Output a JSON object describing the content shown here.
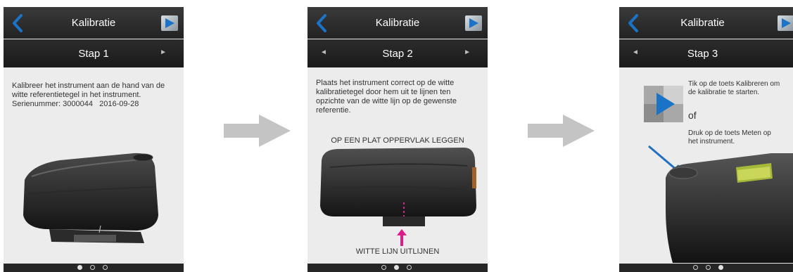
{
  "screens": [
    {
      "title": "Kalibratie",
      "step": "Stap 1",
      "description": [
        "Kalibreer het instrument aan de hand van de",
        "witte referentietegel in het instrument."
      ],
      "serial_label": "Serienummer: 3000044",
      "date": "2016-09-28"
    },
    {
      "title": "Kalibratie",
      "step": "Stap 2",
      "description": [
        "Plaats het instrument correct op de witte",
        "kalibratietegel door hem uit te lijnen ten",
        "opzichte van de witte lijn op de gewenste",
        "referentie."
      ],
      "top_caption": "OP EEN PLAT OPPERVLAK LEGGEN",
      "bottom_caption": "WITTE LIJN UITLIJNEN"
    },
    {
      "title": "Kalibratie",
      "step": "Stap 3",
      "tip": [
        "Tik op de toets Kalibreren om",
        "de kalibratie te starten."
      ],
      "or": "of",
      "alt": [
        "Druk op de toets Meten op",
        "het instrument."
      ]
    }
  ],
  "colors": {
    "accent_blue": "#1a73c7",
    "marker_magenta": "#e0198c",
    "arrow_blue": "#1f6fc2"
  },
  "icons": [
    "back-chevron-icon",
    "play-icon",
    "left-arrow-icon",
    "right-arrow-icon",
    "flow-arrow-icon"
  ],
  "pager": {
    "screen1_active": 0,
    "screen2_active": 1,
    "screen3_active": 2
  }
}
